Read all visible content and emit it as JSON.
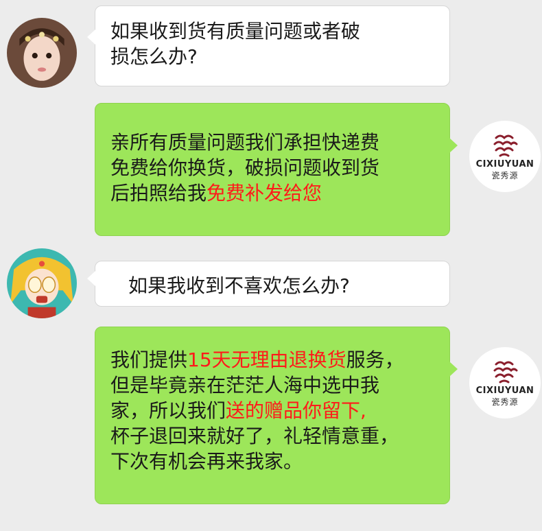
{
  "colors": {
    "bg": "#ececec",
    "left_bubble": "#ffffff",
    "right_bubble": "#9de65a",
    "highlight": "#ff1a1a"
  },
  "brand": {
    "name": "CIXIUYUAN",
    "name_cn": "瓷秀源"
  },
  "messages": [
    {
      "side": "left",
      "avatar": "girl-avatar",
      "lines": [
        "如果收到货有质量问题或者破",
        "损怎么办?"
      ]
    },
    {
      "side": "right",
      "avatar": "brand-logo",
      "line1": "亲所有质量问题我们承担快递费",
      "line2": "免费给你换货，破损问题收到货",
      "line3_a": "后拍照给我",
      "line3_b": "免费补发给您"
    },
    {
      "side": "left",
      "avatar": "cartoon-avatar",
      "lines": [
        "如果我收到不喜欢怎么办?"
      ]
    },
    {
      "side": "right",
      "avatar": "brand-logo",
      "line1_a": "我们提供",
      "line1_b": "15天无理由退换货",
      "line1_c": "服务，",
      "line2": "但是毕竟亲在茫茫人海中选中我",
      "line3_a": "家，所以我们",
      "line3_b": "送的赠品你留下,",
      "line4": "杯子退回来就好了，礼轻情意重，",
      "line5": "下次有机会再来我家。"
    }
  ]
}
